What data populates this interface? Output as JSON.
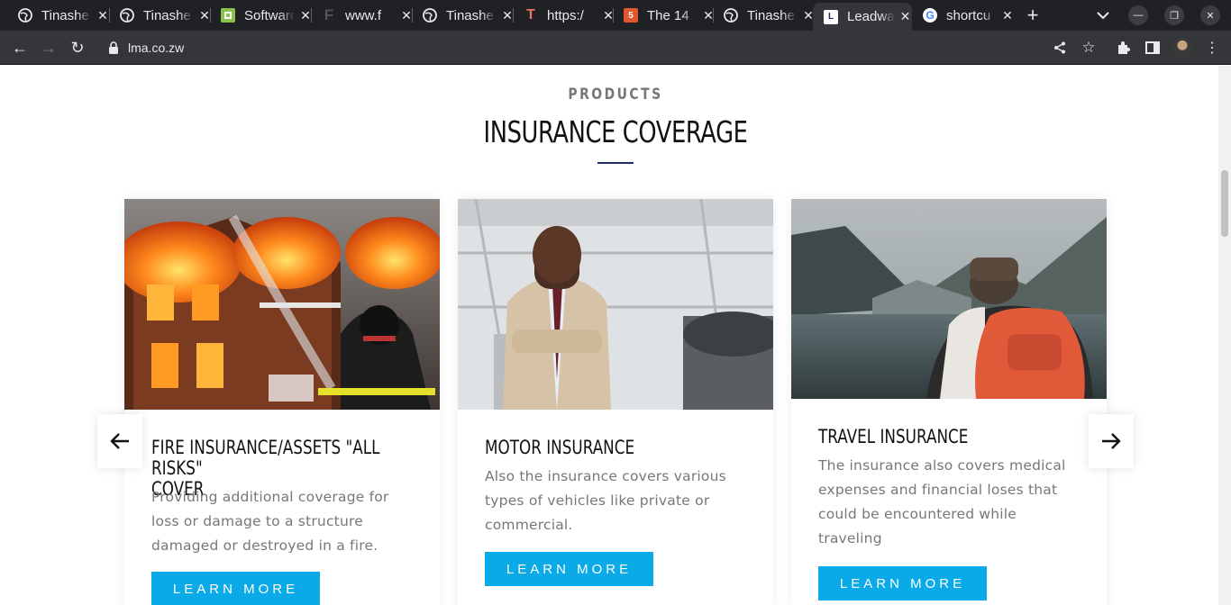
{
  "browser": {
    "tabs": [
      {
        "title": "Tinashe",
        "favicon": "globe-icon"
      },
      {
        "title": "Tinashe",
        "favicon": "globe-icon"
      },
      {
        "title": "Software",
        "favicon": "square-icon"
      },
      {
        "title": "www.f",
        "favicon": "f-logo-icon"
      },
      {
        "title": "Tinashe",
        "favicon": "globe-icon"
      },
      {
        "title": "https:/",
        "favicon": "t-logo-icon"
      },
      {
        "title": "The 14",
        "favicon": "html5-icon"
      },
      {
        "title": "Tinashe",
        "favicon": "globe-icon"
      },
      {
        "title": "Leadway",
        "favicon": "leadway-icon",
        "active": true
      },
      {
        "title": "shortcu",
        "favicon": "google-icon"
      }
    ],
    "url": "lma.co.zw"
  },
  "section": {
    "eyebrow": "PRODUCTS",
    "title": "INSURANCE COVERAGE"
  },
  "cards": [
    {
      "title_line1": "FIRE INSURANCE/ASSETS \"ALL RISKS\"",
      "title_line2": "COVER",
      "description": "Providing additional coverage for loss or damage to a structure damaged or destroyed in a fire.",
      "button": "LEARN MORE"
    },
    {
      "title_line1": "MOTOR INSURANCE",
      "title_line2": "",
      "description": "Also the insurance covers various types of vehicles like private or commercial.",
      "button": "LEARN MORE"
    },
    {
      "title_line1": "TRAVEL INSURANCE",
      "title_line2": "",
      "description": "The insurance also covers medical expenses and financial loses that could be encountered while traveling",
      "button": "LEARN MORE"
    }
  ],
  "colors": {
    "accent": "#0aa9e8",
    "title_rule": "#1d2b6b",
    "chrome_dark": "#202124"
  }
}
